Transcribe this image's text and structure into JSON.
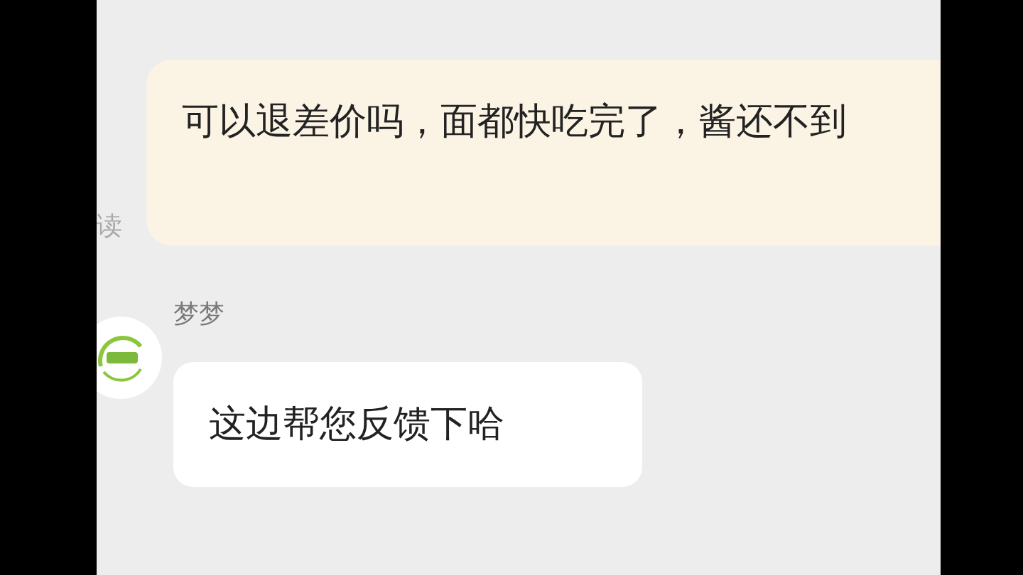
{
  "messages": [
    {
      "kind": "sent",
      "text": "可以退差价吗，面都快吃完了，酱还不到",
      "status": "读"
    },
    {
      "kind": "received",
      "sender": "梦梦",
      "text": "这边帮您反馈下哈"
    }
  ]
}
